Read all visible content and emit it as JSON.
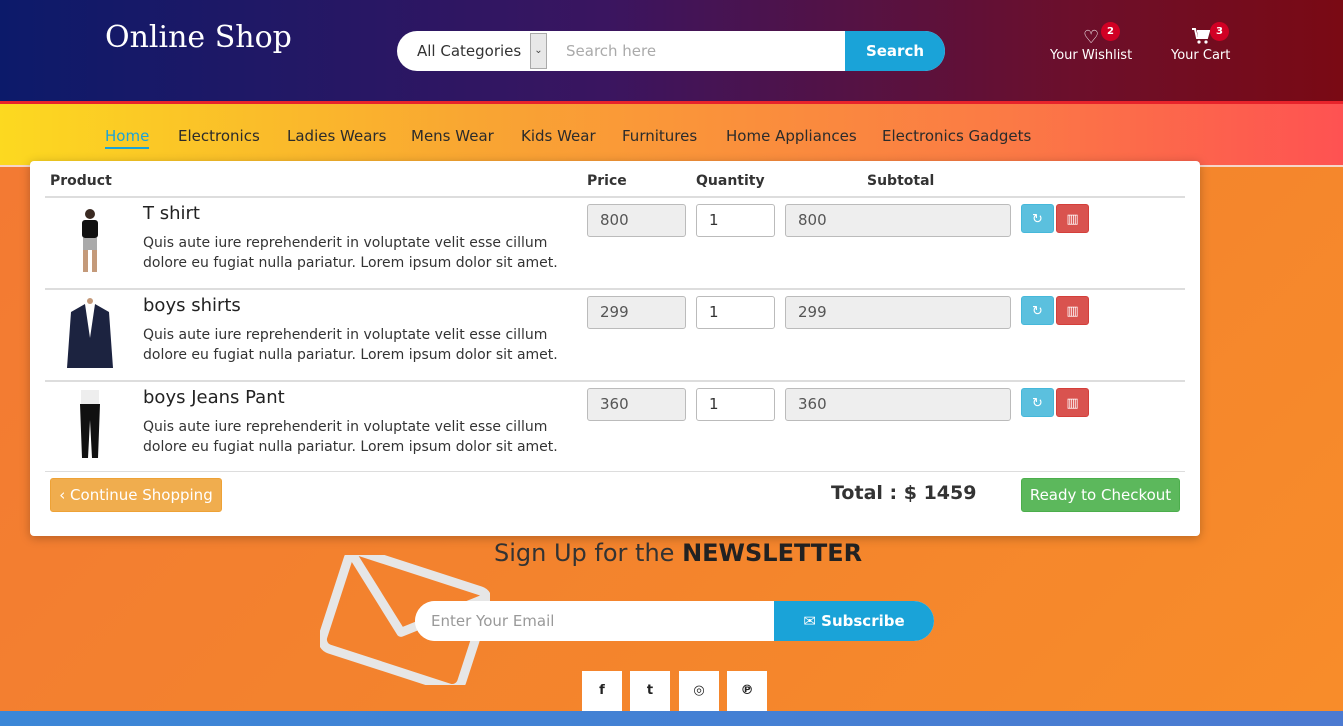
{
  "header": {
    "logo": "Online Shop",
    "category_selected": "All Categories",
    "search_placeholder": "Search here",
    "search_button": "Search",
    "wishlist": {
      "label": "Your Wishlist",
      "count": "2"
    },
    "cart": {
      "label": "Your Cart",
      "count": "3"
    }
  },
  "nav": {
    "items": [
      "Home",
      "Electronics",
      "Ladies Wears",
      "Mens Wear",
      "Kids Wear",
      "Furnitures",
      "Home Appliances",
      "Electronics Gadgets"
    ],
    "active": "Home"
  },
  "cart": {
    "columns": {
      "product": "Product",
      "price": "Price",
      "quantity": "Quantity",
      "subtotal": "Subtotal"
    },
    "items": [
      {
        "name": "T shirt",
        "description": "Quis aute iure reprehenderit in voluptate velit esse cillum dolore eu fugiat nulla pariatur. Lorem ipsum dolor sit amet.",
        "price": "800",
        "quantity": "1",
        "subtotal": "800"
      },
      {
        "name": "boys shirts",
        "description": "Quis aute iure reprehenderit in voluptate velit esse cillum dolore eu fugiat nulla pariatur. Lorem ipsum dolor sit amet.",
        "price": "299",
        "quantity": "1",
        "subtotal": "299"
      },
      {
        "name": "boys Jeans Pant",
        "description": "Quis aute iure reprehenderit in voluptate velit esse cillum dolore eu fugiat nulla pariatur. Lorem ipsum dolor sit amet.",
        "price": "360",
        "quantity": "1",
        "subtotal": "360"
      }
    ],
    "continue_button": "‹ Continue Shopping",
    "total": "Total : $ 1459",
    "checkout_button": "Ready to Checkout"
  },
  "newsletter": {
    "title_prefix": "Sign Up for the ",
    "title_bold": "NEWSLETTER",
    "email_placeholder": "Enter Your Email",
    "subscribe_button": "✉ Subscribe"
  },
  "social": [
    {
      "icon": "facebook-icon",
      "glyph": "f"
    },
    {
      "icon": "twitter-icon",
      "glyph": "t"
    },
    {
      "icon": "instagram-icon",
      "glyph": "◎"
    },
    {
      "icon": "pinterest-icon",
      "glyph": "℗"
    }
  ],
  "colors": {
    "accent": "#1aa3d8",
    "badge": "#d10024",
    "checkout": "#5cb85c",
    "continue": "#f0ad4e",
    "delete": "#d9534f",
    "refresh": "#5bc0de"
  }
}
